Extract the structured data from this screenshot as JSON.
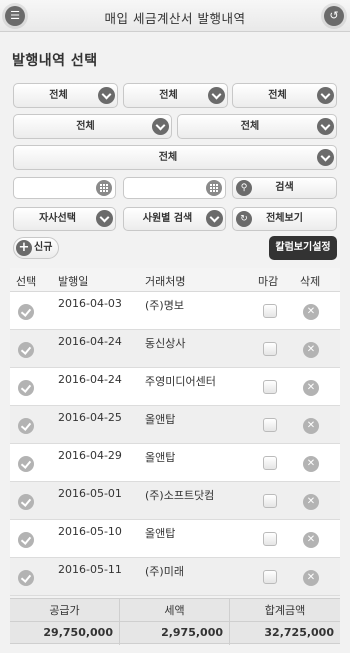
{
  "header": {
    "title": "매입 세금계산서 발행내역",
    "menu_icon": "☰",
    "back_icon": "↺"
  },
  "section_title": "발행내역 선택",
  "filters": {
    "row1": [
      "전체",
      "전체",
      "전체"
    ],
    "row2": [
      "전체",
      "전체"
    ],
    "row3": [
      "전체"
    ],
    "search_label": "검색",
    "company_select": "자사선택",
    "employee_search": "사원별 검색",
    "view_all": "전체보기",
    "date_from": "",
    "date_to": ""
  },
  "actions": {
    "new_label": "신규",
    "column_settings": "칼럼보기설정"
  },
  "grid": {
    "headers": {
      "select": "선택",
      "issue_date": "발행일",
      "vendor": "거래처명",
      "closed": "마감",
      "delete": "삭제"
    },
    "rows": [
      {
        "date": "2016-04-03",
        "vendor": "(주)명보"
      },
      {
        "date": "2016-04-24",
        "vendor": "동신상사"
      },
      {
        "date": "2016-04-24",
        "vendor": "주영미디어센터"
      },
      {
        "date": "2016-04-25",
        "vendor": "올앤탑"
      },
      {
        "date": "2016-04-29",
        "vendor": "올앤탑"
      },
      {
        "date": "2016-05-01",
        "vendor": "(주)소프트닷컴"
      },
      {
        "date": "2016-05-10",
        "vendor": "올앤탑"
      },
      {
        "date": "2016-05-11",
        "vendor": "(주)미래"
      }
    ]
  },
  "totals": {
    "supply_label": "공급가",
    "tax_label": "세액",
    "total_label": "합계금액",
    "supply": "29,750,000",
    "tax": "2,975,000",
    "total": "32,725,000"
  }
}
